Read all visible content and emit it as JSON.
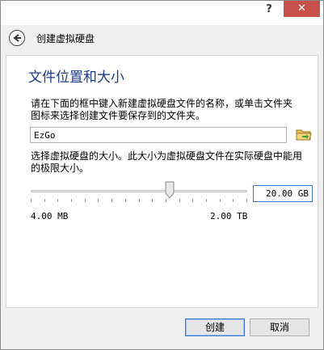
{
  "window": {
    "help_label": "?",
    "close_label": "✕"
  },
  "header": {
    "title": "创建虚拟硬盘",
    "back_icon": "arrow-left-icon"
  },
  "panel": {
    "title": "文件位置和大小",
    "location_description": "请在下面的框中键入新建虚拟硬盘文件的名称，或单击文件夹图标来选择创建文件要保存到的文件夹。",
    "file_name_value": "EzGo",
    "folder_icon": "folder-browse-icon",
    "size_description": "选择虚拟硬盘的大小。此大小为虚拟硬盘文件在实际硬盘中能用的极限大小。",
    "slider_value_fraction": 0.64,
    "size_value": "20.00 GB",
    "min_size_label": "4.00 MB",
    "max_size_label": "2.00 TB"
  },
  "buttons": {
    "create_label": "创建",
    "cancel_label": "取消"
  },
  "colors": {
    "close_button": "#c7504b",
    "title_text": "#1e3a8a",
    "focus_border": "#3a77d5"
  }
}
